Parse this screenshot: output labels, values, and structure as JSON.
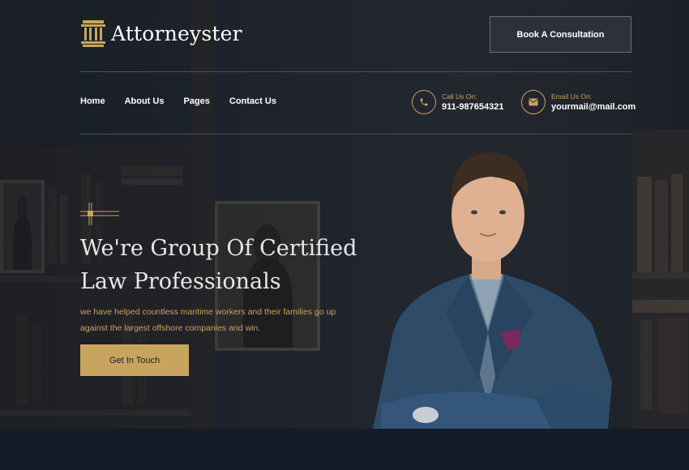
{
  "header": {
    "logo_text": "Attorneyster",
    "book_button": "Book A Consultation"
  },
  "nav": {
    "items": [
      "Home",
      "About Us",
      "Pages",
      "Contact Us"
    ]
  },
  "contact": {
    "call_label": "Call Us On:",
    "call_value": "911-987654321",
    "email_label": "Email Us On:",
    "email_value": "yourmail@mail.com"
  },
  "hero": {
    "headline_line1": "We're Group Of Certified",
    "headline_line2": "Law Professionals",
    "subtext": "we have helped countless maritime workers and their families go up against the largest offshore companies and win.",
    "cta": "Get In Touch"
  },
  "colors": {
    "accent": "#c9a45a",
    "button_gold": "#c8a55e",
    "background": "#1f2530",
    "bottom_band": "#151b27"
  },
  "icons": [
    "pillar-logo-icon",
    "phone-icon",
    "mail-icon",
    "decorative-cross-icon"
  ]
}
